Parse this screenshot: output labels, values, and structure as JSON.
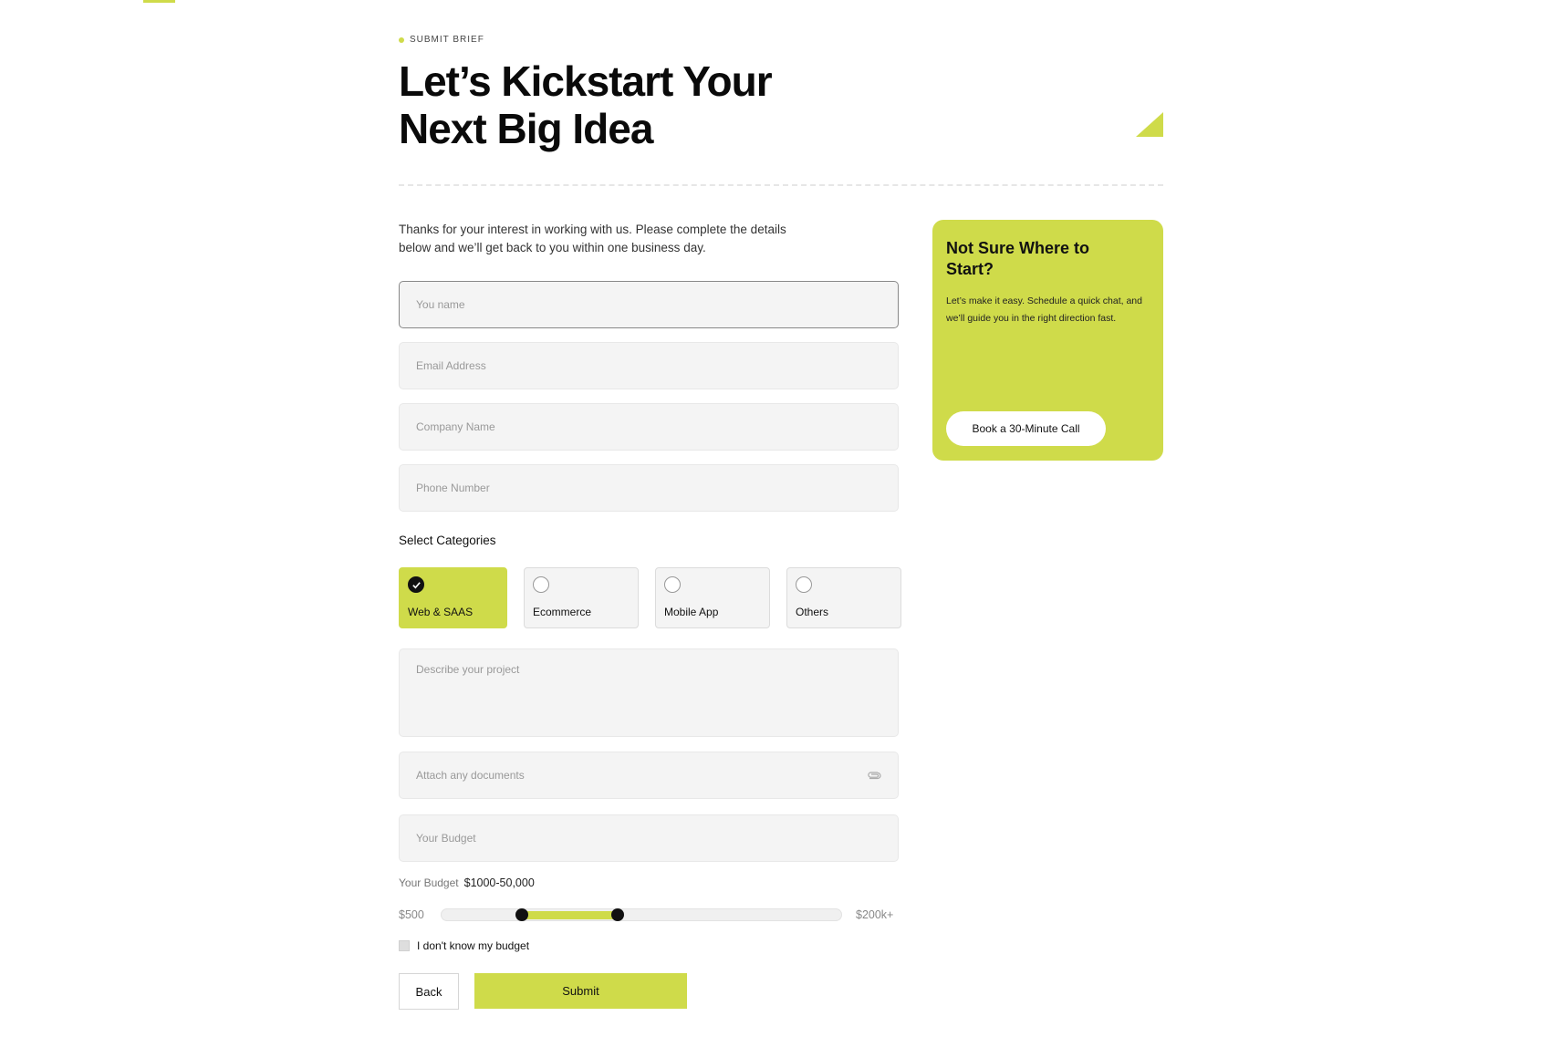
{
  "header": {
    "eyebrow": "SUBMIT BRIEF",
    "title": "Let’s Kickstart Your Next Big Idea"
  },
  "form": {
    "intro": "Thanks for your interest in working with us. Please complete the details below and we’ll get back to you within one business day.",
    "name_placeholder": "You name",
    "email_placeholder": "Email Address",
    "company_placeholder": "Company Name",
    "phone_placeholder": "Phone Number",
    "categories_label": "Select Categories",
    "categories": [
      {
        "label": "Web & SAAS",
        "selected": true
      },
      {
        "label": "Ecommerce",
        "selected": false
      },
      {
        "label": "Mobile App",
        "selected": false
      },
      {
        "label": "Others",
        "selected": false
      }
    ],
    "description_placeholder": "Describe your project",
    "attach_placeholder": "Attach any documents",
    "attach_icon": "paperclip-icon",
    "budget_placeholder": "Your Budget",
    "budget_label": "Your Budget",
    "budget_value": "$1000-50,000",
    "slider": {
      "min_label": "$500",
      "max_label": "$200k+",
      "range_start_fraction": 0.2,
      "range_end_fraction": 0.44
    },
    "unknown_budget_label": "I don't know my budget",
    "back_label": "Back",
    "submit_label": "Submit"
  },
  "sidebar_card": {
    "title": "Not Sure Where to Start?",
    "text": "Let’s make it easy. Schedule a quick chat, and we’ll guide you in the right direction fast.",
    "button_label": "Book a 30-Minute Call"
  },
  "colors": {
    "accent": "#cfdb4a",
    "field_bg": "#f4f4f4",
    "text": "#111111"
  }
}
